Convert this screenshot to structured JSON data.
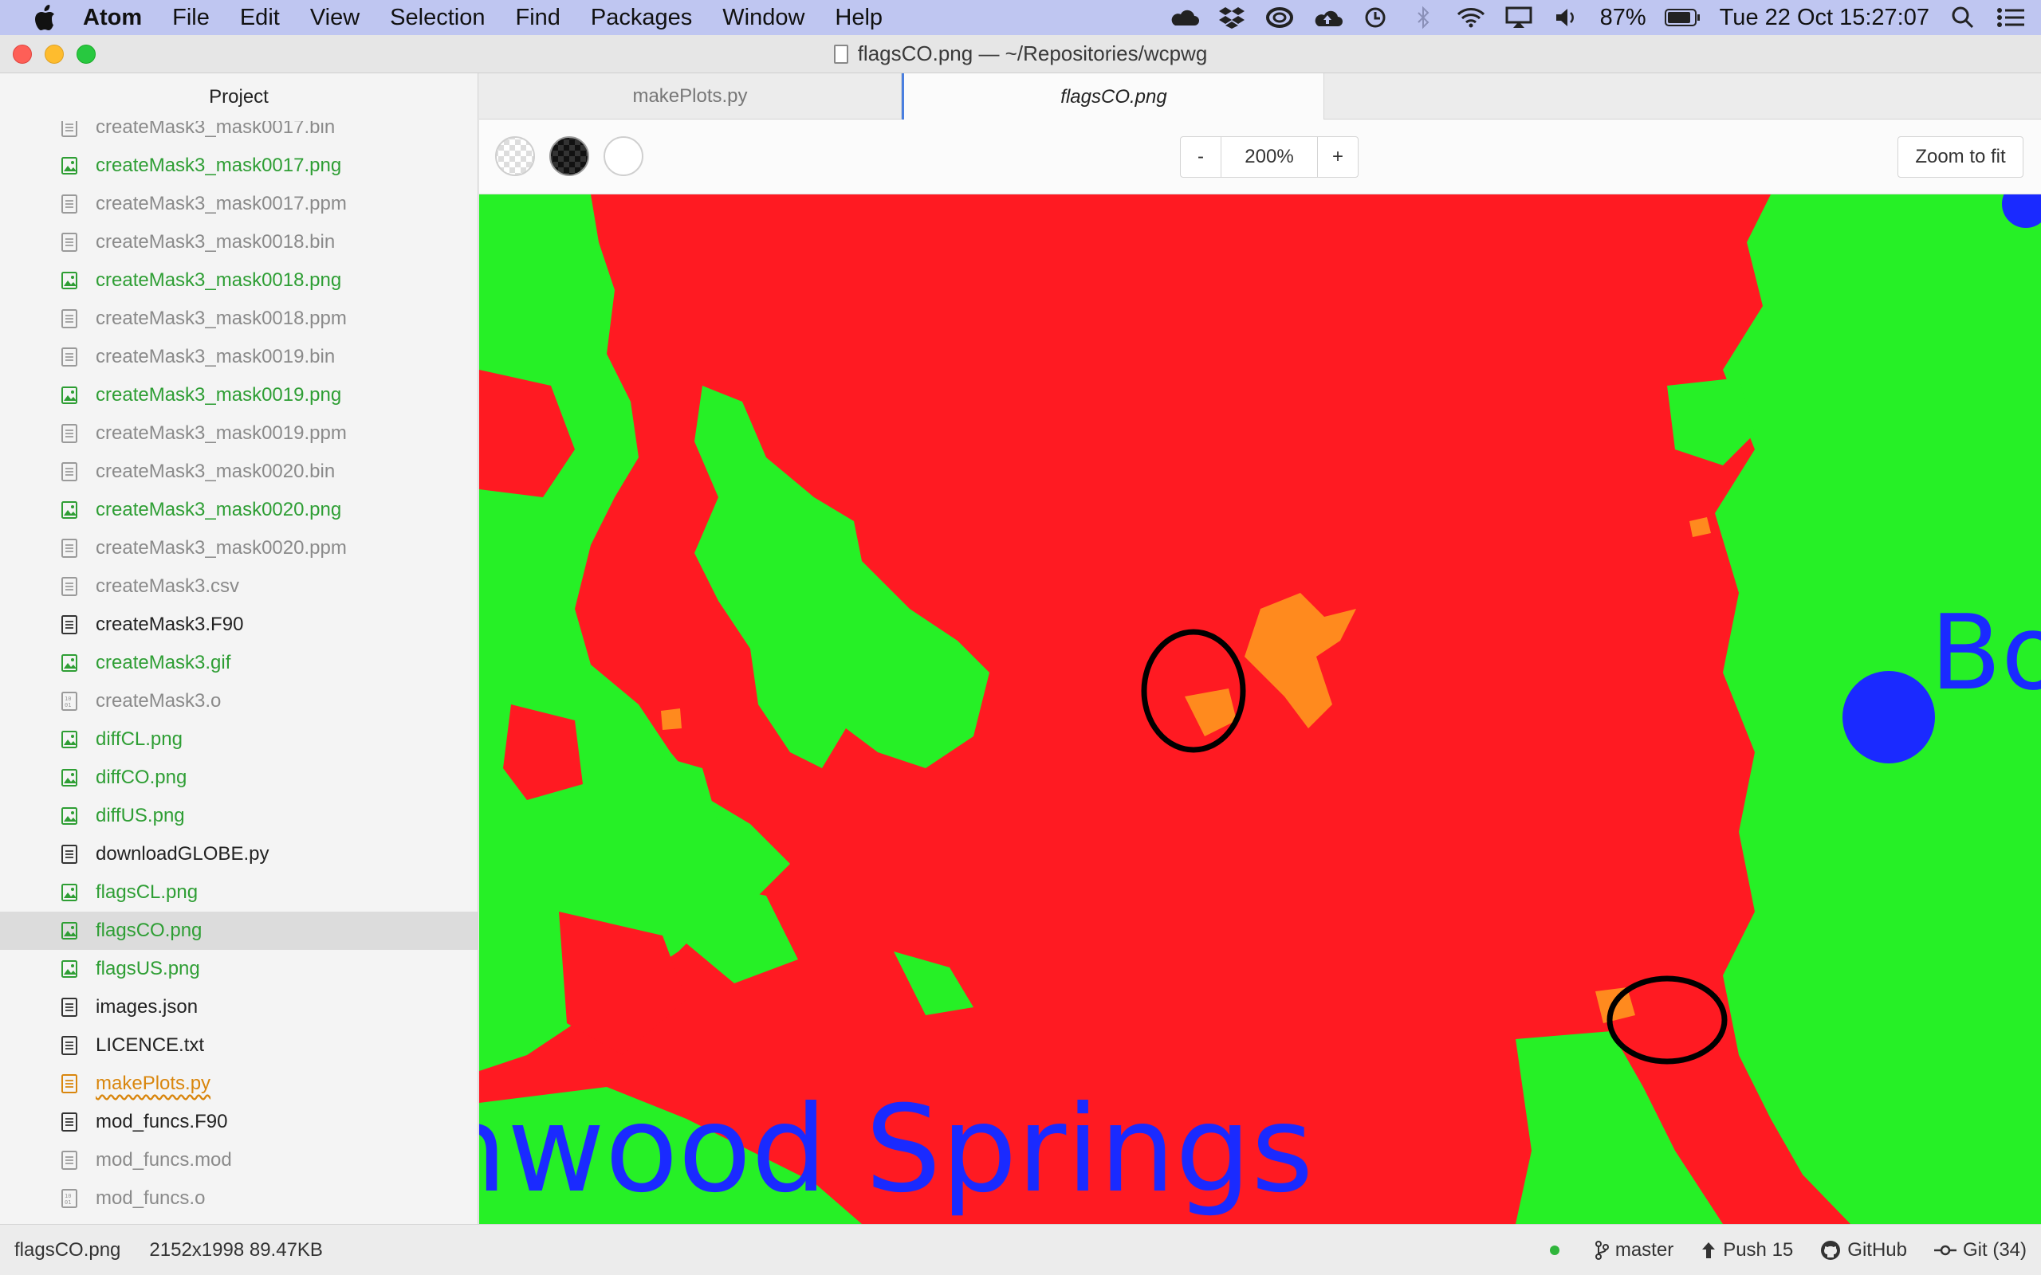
{
  "menubar": {
    "app": "Atom",
    "items": [
      "File",
      "Edit",
      "View",
      "Selection",
      "Find",
      "Packages",
      "Window",
      "Help"
    ],
    "battery": "87%",
    "datetime": "Tue 22 Oct  15:27:07"
  },
  "window": {
    "title": "flagsCO.png — ~/Repositories/wcpwg"
  },
  "sidebar": {
    "header": "Project",
    "items": [
      {
        "label": "createMask3_mask0017.bin",
        "type": "text",
        "color": "gray"
      },
      {
        "label": "createMask3_mask0017.png",
        "type": "image",
        "color": "green"
      },
      {
        "label": "createMask3_mask0017.ppm",
        "type": "text",
        "color": "gray"
      },
      {
        "label": "createMask3_mask0018.bin",
        "type": "text",
        "color": "gray"
      },
      {
        "label": "createMask3_mask0018.png",
        "type": "image",
        "color": "green"
      },
      {
        "label": "createMask3_mask0018.ppm",
        "type": "text",
        "color": "gray"
      },
      {
        "label": "createMask3_mask0019.bin",
        "type": "text",
        "color": "gray"
      },
      {
        "label": "createMask3_mask0019.png",
        "type": "image",
        "color": "green"
      },
      {
        "label": "createMask3_mask0019.ppm",
        "type": "text",
        "color": "gray"
      },
      {
        "label": "createMask3_mask0020.bin",
        "type": "text",
        "color": "gray"
      },
      {
        "label": "createMask3_mask0020.png",
        "type": "image",
        "color": "green"
      },
      {
        "label": "createMask3_mask0020.ppm",
        "type": "text",
        "color": "gray"
      },
      {
        "label": "createMask3.csv",
        "type": "text",
        "color": "gray"
      },
      {
        "label": "createMask3.F90",
        "type": "text",
        "color": "black"
      },
      {
        "label": "createMask3.gif",
        "type": "image",
        "color": "green"
      },
      {
        "label": "createMask3.o",
        "type": "binary",
        "color": "gray"
      },
      {
        "label": "diffCL.png",
        "type": "image",
        "color": "green"
      },
      {
        "label": "diffCO.png",
        "type": "image",
        "color": "green"
      },
      {
        "label": "diffUS.png",
        "type": "image",
        "color": "green"
      },
      {
        "label": "downloadGLOBE.py",
        "type": "text",
        "color": "black"
      },
      {
        "label": "flagsCL.png",
        "type": "image",
        "color": "green"
      },
      {
        "label": "flagsCO.png",
        "type": "image",
        "color": "green",
        "selected": true
      },
      {
        "label": "flagsUS.png",
        "type": "image",
        "color": "green"
      },
      {
        "label": "images.json",
        "type": "text",
        "color": "black"
      },
      {
        "label": "LICENCE.txt",
        "type": "text",
        "color": "black"
      },
      {
        "label": "makePlots.py",
        "type": "text",
        "color": "orange",
        "modified": true
      },
      {
        "label": "mod_funcs.F90",
        "type": "text",
        "color": "black"
      },
      {
        "label": "mod_funcs.mod",
        "type": "text",
        "color": "gray"
      },
      {
        "label": "mod_funcs.o",
        "type": "binary",
        "color": "gray"
      }
    ]
  },
  "tabs": [
    {
      "label": "makePlots.py",
      "active": false
    },
    {
      "label": "flagsCO.png",
      "active": true
    }
  ],
  "image_controls": {
    "zoom_out": "-",
    "zoom_value": "200%",
    "zoom_in": "+",
    "zoom_fit": "Zoom to fit"
  },
  "image": {
    "text_springs": "nwood Springs",
    "text_bo": "Bo",
    "colors": {
      "red": "#ff1a22",
      "green": "#26f026",
      "orange": "#ff8a1e",
      "blue": "#1a2aff"
    }
  },
  "statusbar": {
    "filename": "flagsCO.png",
    "info": "2152x1998 89.47KB",
    "branch": "master",
    "push": "Push 15",
    "github": "GitHub",
    "git": "Git (34)"
  }
}
